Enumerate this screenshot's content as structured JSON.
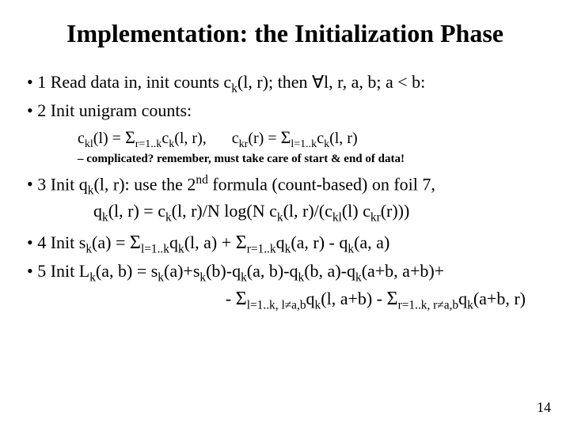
{
  "title": "Implementation: the Initialization Phase",
  "b1": "1 Read data in, init counts c<sub>k</sub>(l, r); then ∀l, r, a, b; a < b:",
  "b2": "2 Init unigram counts:",
  "formula_ckl": "c<sub>kl</sub>(l) = <span class=\"sig\">Σ</span><sub>r=1..k</sub>c<sub>k</sub>(l, r),<span class=\"gap\"></span>c<sub>kr</sub>(r) = <span class=\"sig\">Σ</span><sub>l=1..k</sub>c<sub>k</sub>(l, r)",
  "note": "complicated? remember, must take care of start & end of data!",
  "b3": "3 Init q<sub>k</sub>(l, r): use the 2<sup>nd</sup> formula (count-based) on foil 7,",
  "formula_qk": "q<sub>k</sub>(l, r) = c<sub>k</sub>(l, r)/N log(N c<sub>k</sub>(l, r)/(c<sub>kl</sub>(l) c<sub>kr</sub>(r)))",
  "b4": "4 Init s<sub>k</sub>(a) = <span class=\"sig\">Σ</span><sub>l=1..k</sub>q<sub>k</sub>(l, a) + <span class=\"sig\">Σ</span><sub>r=1..k</sub>q<sub>k</sub>(a, r) - q<sub>k</sub>(a, a)",
  "b5": "5 Init L<sub>k</sub>(a, b) = s<sub>k</sub>(a)+s<sub>k</sub>(b)-q<sub>k</sub>(a, b)-q<sub>k</sub>(b, a)-q<sub>k</sub>(a+b, a+b)+",
  "formula_Lk2": "- <span class=\"sig\">Σ</span><sub>l=1..k, l≠a,b</sub>q<sub>k</sub>(l, a+b) - <span class=\"sig\">Σ</span><sub>r=1..k, r≠a,b</sub>q<sub>k</sub>(a+b, r)",
  "pageno": "14"
}
